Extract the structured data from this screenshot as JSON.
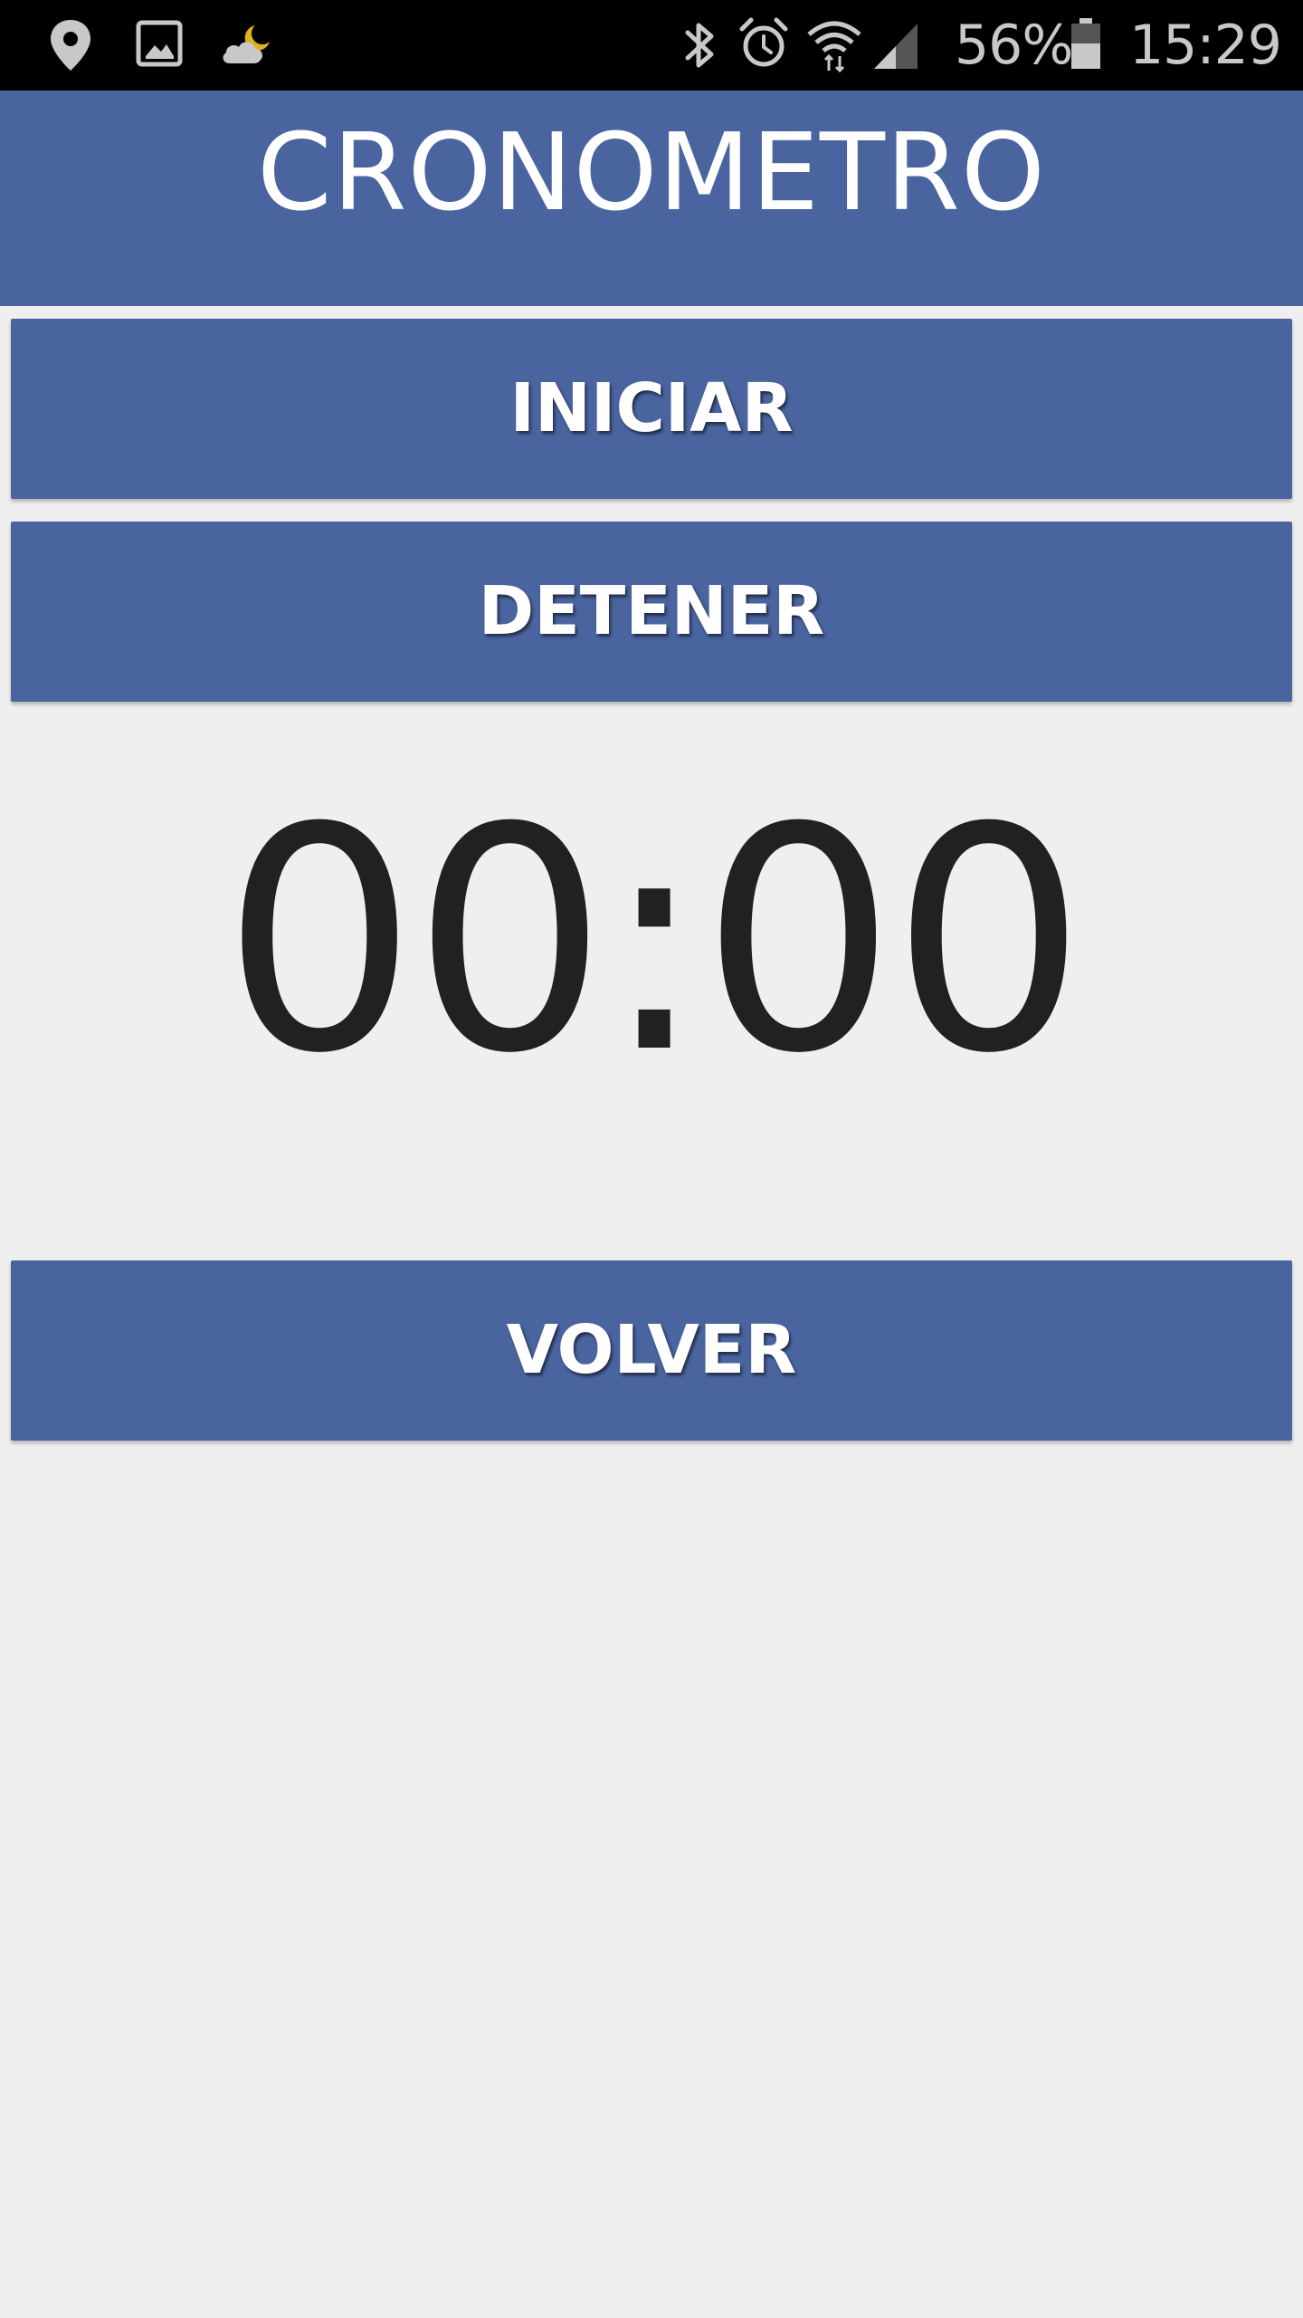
{
  "status_bar": {
    "left_icons": [
      "location-pin-icon",
      "image-icon",
      "weather-cloud-moon-icon"
    ],
    "right_icons": [
      "bluetooth-icon",
      "alarm-icon",
      "wifi-icon",
      "signal-icon",
      "battery-icon"
    ],
    "battery_percent": "56%",
    "time": "15:29",
    "colors": {
      "background": "#000000",
      "icon": "#c8c8c8",
      "moon": "#e0b020"
    }
  },
  "app_bar": {
    "title": "CRONOMETRO"
  },
  "buttons": {
    "start_label": "INICIAR",
    "stop_label": "DETENER",
    "back_label": "VOLVER"
  },
  "timer": {
    "display": "00:00"
  },
  "colors": {
    "primary": "#4a64a0",
    "background": "#efefef",
    "timer_text": "#212121",
    "button_text": "#ffffff"
  }
}
